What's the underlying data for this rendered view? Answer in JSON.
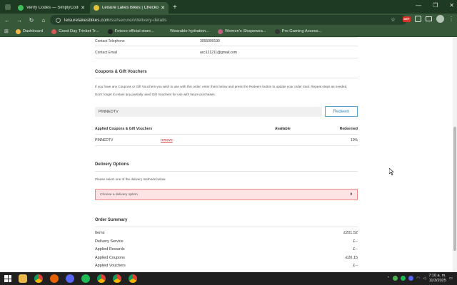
{
  "browser": {
    "tabs": [
      {
        "title": "Verify Codes — SimplyCodes",
        "active": false,
        "favicon_color": "#3fbf5a"
      },
      {
        "title": "Leisure Lakes Bikes | Checkout",
        "active": true,
        "favicon_color": "#e5c33b"
      }
    ],
    "url_host": "leisurelakesbikes.com",
    "url_path": "/ssl/secure/#delivery-details",
    "ext_badge": "DEF",
    "bookmarks": [
      {
        "label": "Dashboard",
        "color": "#f2b84b"
      },
      {
        "label": "Good Day Trinket Tr...",
        "color": "#d35a5a"
      },
      {
        "label": "Foteoo official store...",
        "color": "#222222"
      },
      {
        "label": "Wearable hydration...",
        "color": "#38583a"
      },
      {
        "label": "Women's Shapewea...",
        "color": "#c06080"
      },
      {
        "label": "Pro Gaming Access...",
        "color": "#333333"
      }
    ]
  },
  "contact": {
    "telephone_label": "Contact Telephone",
    "telephone_value": "3055009190",
    "email_label": "Contact Email",
    "email_value": "acc121211@gmail.com"
  },
  "vouchers": {
    "heading": "Coupons & Gift Vouchers",
    "instructions": "If you have any Coupons or Gift Vouchers you wish to use with this order, enter them below and press the Redeem button to update your order total. Repeat steps as needed.",
    "retain_note": "Don't forget to retain any partially used Gift Vouchers for use with future purchases.",
    "input_value": "PINNEDTV",
    "redeem_label": "Redeem",
    "table_headers": {
      "name": "Applied Coupons & Gift Vouchers",
      "available": "Available",
      "redeemed": "Redeemed"
    },
    "applied": [
      {
        "code": "PINNEDTV",
        "remove_label": "remove",
        "available": "",
        "redeemed": "10%"
      }
    ]
  },
  "delivery": {
    "heading": "Delivery Options",
    "instructions": "Please select one of the delivery methods below.",
    "select_value": "Choose a delivery option"
  },
  "summary": {
    "heading": "Order Summary",
    "rows": [
      {
        "label": "Items",
        "amount": "£201.52"
      },
      {
        "label": "Delivery Service",
        "amount": "£--"
      },
      {
        "label": "Applied Rewards",
        "amount": "£--"
      },
      {
        "label": "Applied Coupons",
        "amount": "-£20.15"
      },
      {
        "label": "Applied Vouchers",
        "amount": "£--"
      }
    ]
  },
  "taskbar": {
    "time": "7:10 a. m.",
    "date": "11/3/2025"
  }
}
